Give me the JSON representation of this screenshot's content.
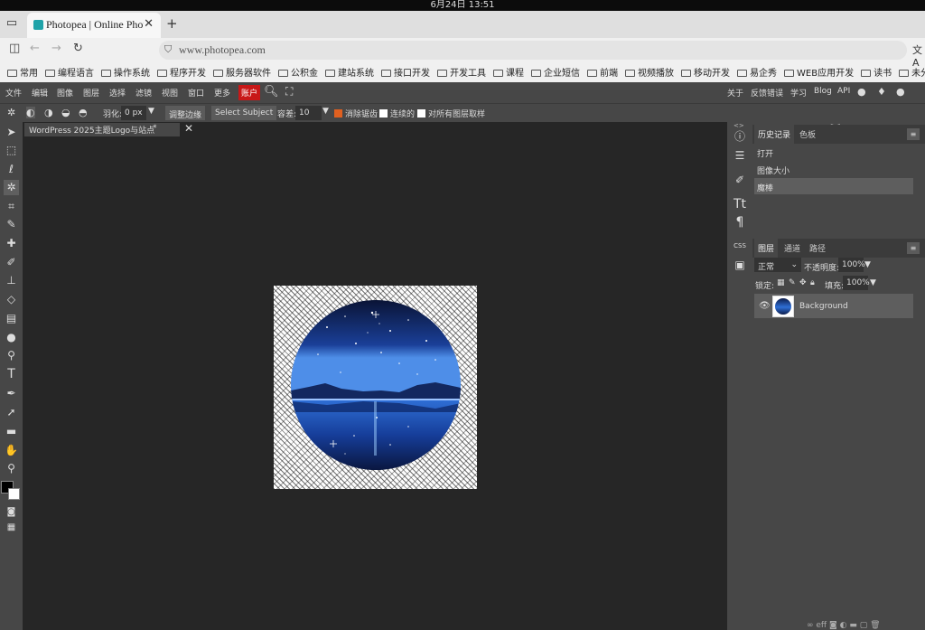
{
  "system": {
    "clock": "6月24日 13:51"
  },
  "browser": {
    "tab_title": "Photopea | Online Phot",
    "url": "www.photopea.com",
    "bookmarks": [
      "常用",
      "编程语言",
      "操作系统",
      "程序开发",
      "服务器软件",
      "公积金",
      "建站系统",
      "接口开发",
      "开发工具",
      "课程",
      "企业短信",
      "前端",
      "视频播放",
      "移动开发",
      "易企秀",
      "WEB应用开发",
      "读书",
      "未分类书签"
    ]
  },
  "menubar": {
    "file": "文件",
    "edit": "编辑",
    "image": "图像",
    "layer": "图层",
    "select": "选择",
    "filter": "滤镜",
    "view": "视图",
    "window": "窗口",
    "more": "更多",
    "account": "账户",
    "about": "关于",
    "feedback": "反馈错误",
    "learn": "学习",
    "blog": "Blog",
    "api": "API"
  },
  "options": {
    "feather_label": "羽化:",
    "feather_value": "0 px",
    "refine_edge": "调整边缘",
    "select_subject": "Select Subject",
    "tolerance_label": "容差:",
    "tolerance_value": "10",
    "antialias": "消除锯齿",
    "contiguous": "连续的",
    "sample_all": "对所有图层取样"
  },
  "document": {
    "tab": "WordPress 2025主题Logo与站点",
    "modified": "*"
  },
  "history": {
    "tab": "历史记录",
    "swatches_tab": "色板",
    "items": [
      "打开",
      "图像大小",
      "魔棒"
    ]
  },
  "layers": {
    "tab": "图层",
    "channels_tab": "通道",
    "paths_tab": "路径",
    "blend_mode": "正常",
    "opacity_label": "不透明度:",
    "opacity": "100%",
    "lock_label": "锁定:",
    "fill_label": "填充:",
    "fill": "100%",
    "items": [
      {
        "name": "Background"
      }
    ],
    "footer": "eff"
  },
  "colors": {
    "foreground": "#000000",
    "background": "#ffffff",
    "account_red": "#c81818"
  }
}
